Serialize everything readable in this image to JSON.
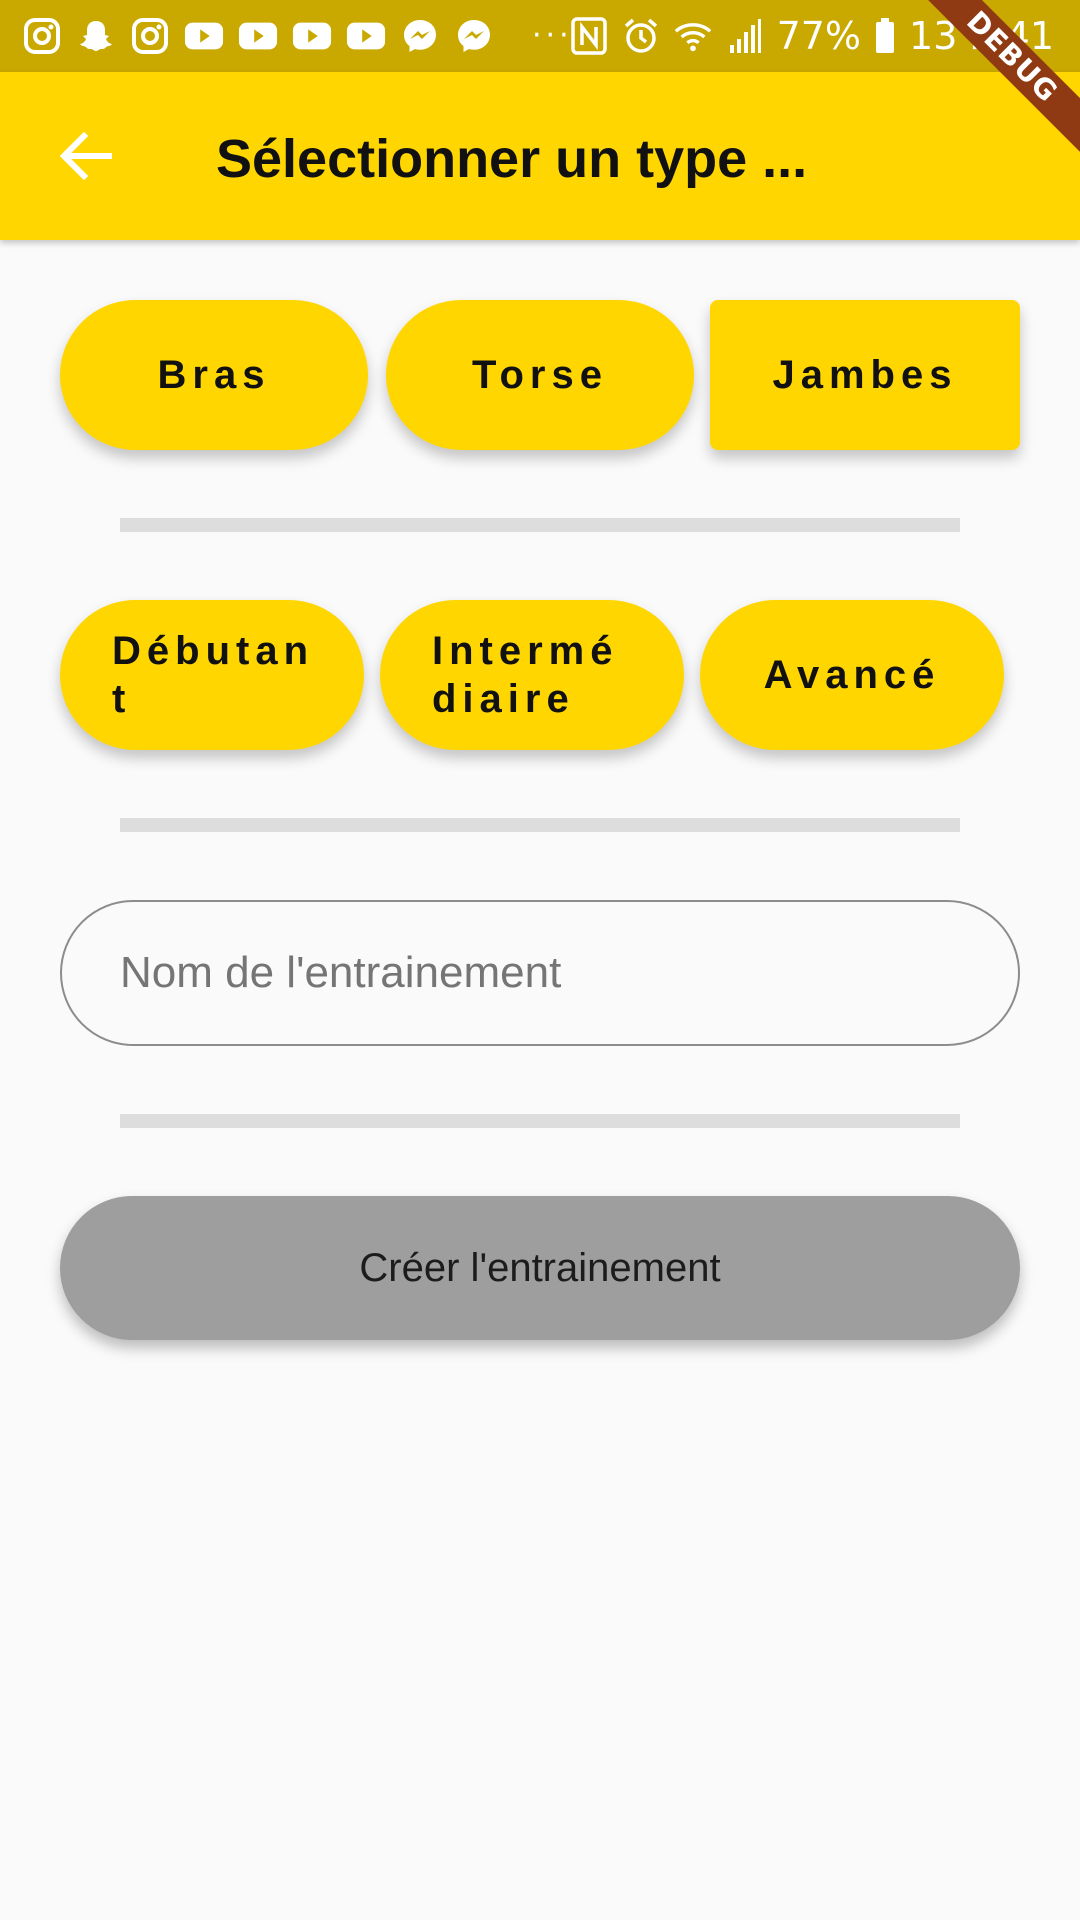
{
  "status_bar": {
    "notification_icons": [
      "instagram-icon",
      "snapchat-icon",
      "instagram-icon",
      "youtube-icon",
      "youtube-icon",
      "youtube-icon",
      "youtube-icon",
      "messenger-icon",
      "messenger-icon"
    ],
    "more_dots": "···",
    "battery_percent": "77%",
    "time": "13 h 41",
    "system_icons": [
      "nfc-icon",
      "alarm-icon",
      "wifi-icon",
      "signal-icon",
      "battery-icon"
    ]
  },
  "debug_banner": "DEBUG",
  "app_bar": {
    "title": "Sélectionner un type ...",
    "back_icon": "arrow-back-icon"
  },
  "body_part_options": {
    "items": [
      {
        "label": "Bras",
        "selected": false
      },
      {
        "label": "Torse",
        "selected": false
      },
      {
        "label": "Jambes",
        "selected": true
      }
    ]
  },
  "level_options": {
    "items": [
      {
        "label": "Débutant",
        "line1": "Débutan",
        "line2": "t"
      },
      {
        "label": "Intermédiaire",
        "line1": "Intermé",
        "line2": "diaire"
      },
      {
        "label": "Avancé"
      }
    ]
  },
  "name_field": {
    "placeholder": "Nom de l'entrainement",
    "value": ""
  },
  "create_button": {
    "label": "Créer l'entrainement",
    "enabled": false
  },
  "colors": {
    "accent": "#ffd600",
    "status_bar": "#c9a800",
    "disabled_button": "#9e9e9e",
    "divider": "#dddddd",
    "background": "#fafafa"
  }
}
